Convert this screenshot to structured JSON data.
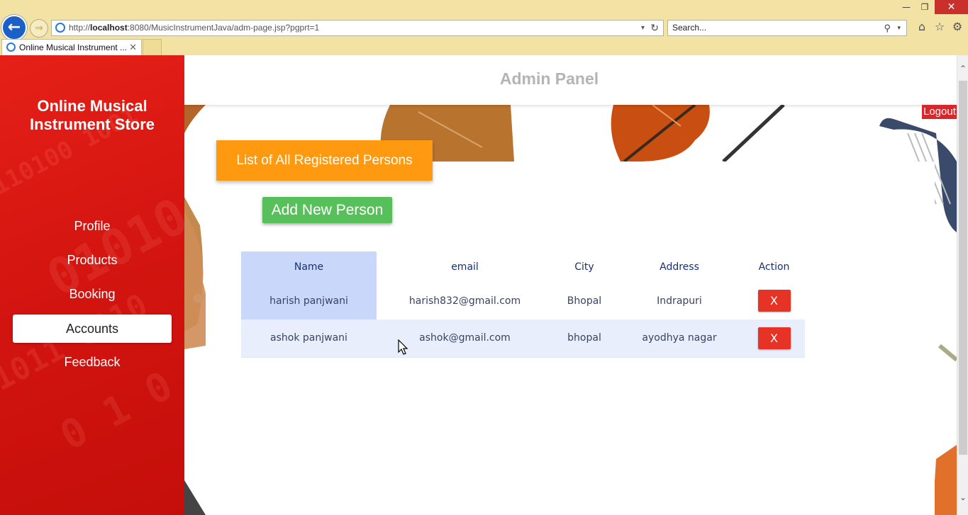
{
  "browser": {
    "url_prefix": "http://",
    "url_host": "localhost",
    "url_rest": ":8080/MusicInstrumentJava/adm-page.jsp?pgprt=1",
    "search_placeholder": "Search...",
    "tab_title": "Online Musical Instrument ...",
    "icons": [
      "back-arrow-icon",
      "forward-arrow-icon",
      "ie-icon",
      "refresh-icon",
      "search-icon",
      "home-icon",
      "star-icon",
      "gear-icon"
    ]
  },
  "sidebar": {
    "title_line1": "Online Musical",
    "title_line2": "Instrument Store",
    "items": [
      {
        "label": "Profile",
        "active": false
      },
      {
        "label": "Products",
        "active": false
      },
      {
        "label": "Booking",
        "active": false
      },
      {
        "label": "Accounts",
        "active": true
      },
      {
        "label": "Feedback",
        "active": false
      }
    ]
  },
  "header": {
    "title": "Admin Panel",
    "logout_label": "Logout"
  },
  "main": {
    "list_button_label": "List of All Registered Persons",
    "add_button_label": "Add New Person",
    "table": {
      "columns": [
        "Name",
        "email",
        "City",
        "Address",
        "Action"
      ],
      "rows": [
        {
          "name": "harish panjwani",
          "email": "harish832@gmail.com",
          "city": "Bhopal",
          "address": "Indrapuri",
          "action": "X"
        },
        {
          "name": "ashok panjwani",
          "email": "ashok@gmail.com",
          "city": "bhopal",
          "address": "ayodhya nagar",
          "action": "X"
        }
      ]
    }
  },
  "colors": {
    "sidebar_red": "#d41510",
    "list_button_orange": "#ff9a10",
    "add_button_green": "#58c05a",
    "delete_red": "#e63326",
    "name_column_blue": "#c9d7fb",
    "logout_red": "#d9262a"
  }
}
